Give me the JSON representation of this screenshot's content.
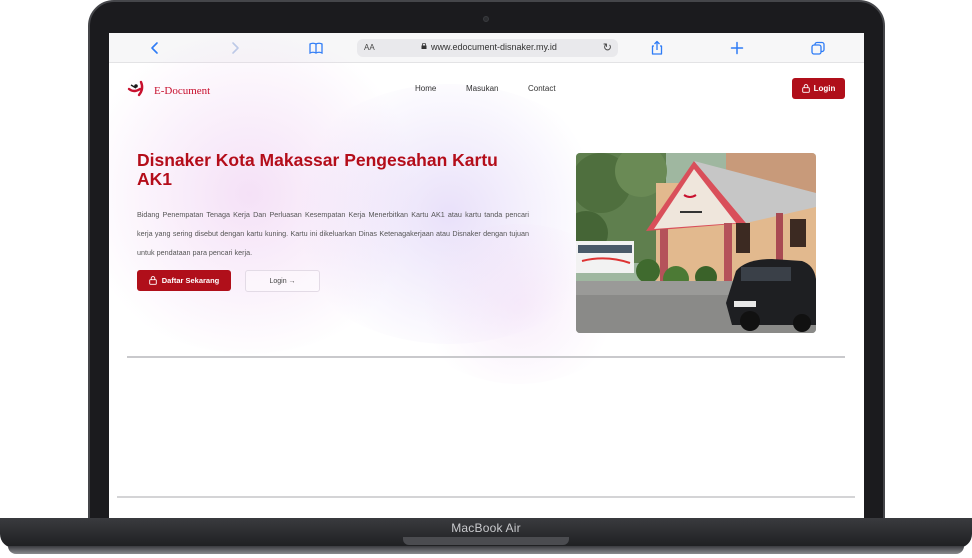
{
  "device": {
    "label": "MacBook Air"
  },
  "browser": {
    "aa_label": "AA",
    "url": "www.edocument-disnaker.my.id"
  },
  "site": {
    "brand": "E-Document",
    "nav": [
      "Home",
      "Masukan",
      "Contact"
    ],
    "login_label": "Login"
  },
  "hero": {
    "title": "Disnaker Kota Makassar Pengesahan Kartu AK1",
    "description": "Bidang Penempatan Tenaga Kerja Dan Perluasan Kesempatan Kerja Menerbitkan Kartu AK1 atau kartu tanda pencari kerja yang sering disebut dengan kartu kuning. Kartu ini dikeluarkan Dinas Ketenagakerjaan atau Disnaker dengan tujuan untuk pendataan para pencari kerja.",
    "primary_button": "Daftar Sekarang",
    "secondary_button": "Login →"
  },
  "colors": {
    "brand_red": "#b00f1a",
    "title_red": "#b40d1a",
    "browser_blue": "#2e7cf6"
  }
}
